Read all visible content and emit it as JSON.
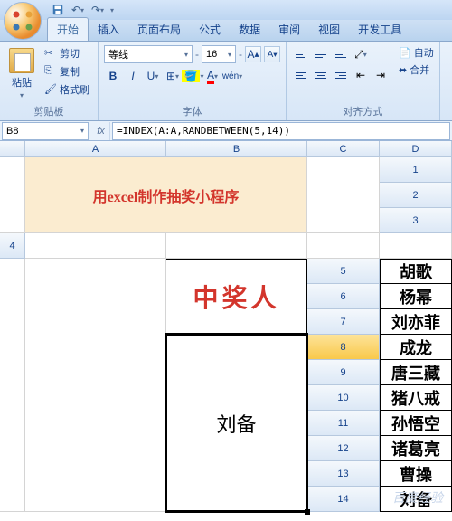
{
  "qat": {
    "save": "save-icon",
    "undo": "undo-icon",
    "redo": "redo-icon"
  },
  "tabs": {
    "items": [
      "开始",
      "插入",
      "页面布局",
      "公式",
      "数据",
      "审阅",
      "视图",
      "开发工具"
    ],
    "active_index": 0
  },
  "ribbon": {
    "clipboard": {
      "label": "剪贴板",
      "paste": "粘贴",
      "cut": "剪切",
      "copy": "复制",
      "format_painter": "格式刷"
    },
    "font": {
      "label": "字体",
      "name": "等线",
      "size": "16",
      "increase": "A",
      "decrease": "A",
      "bold": "B",
      "italic": "I",
      "underline": "U"
    },
    "align": {
      "label": "对齐方式",
      "wrap": "自动",
      "merge": "合并"
    }
  },
  "formula_bar": {
    "cell_ref": "B8",
    "formula": "=INDEX(A:A,RANDBETWEEN(5,14))"
  },
  "columns": [
    "A",
    "B",
    "C",
    "D"
  ],
  "rows": [
    "1",
    "2",
    "3",
    "4",
    "5",
    "6",
    "7",
    "8",
    "9",
    "10",
    "11",
    "12",
    "13",
    "14"
  ],
  "title_cell": "用excel制作抽奖小程序",
  "names": [
    "胡歌",
    "杨幂",
    "刘亦菲",
    "成龙",
    "唐三藏",
    "猪八戒",
    "孙悟空",
    "诸葛亮",
    "曹操",
    "刘备"
  ],
  "winner_label": "中奖人",
  "winner_value": "刘备",
  "watermark": "百度经验"
}
